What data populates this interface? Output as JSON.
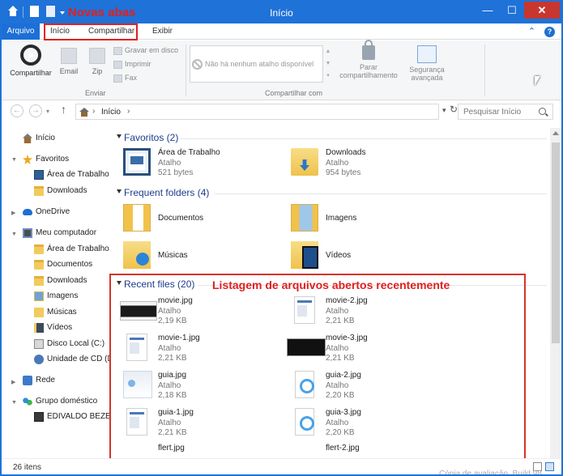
{
  "titlebar": {
    "title": "Início",
    "annotation": "Novas abas",
    "minimize_glyph": "—",
    "maximize_glyph": "☐",
    "close_glyph": "✕"
  },
  "tabs": {
    "arquivo": "Arquivo",
    "inicio": "Início",
    "compartilhar": "Compartilhar",
    "exibir": "Exibir",
    "collapse_glyph": "⌃",
    "help_glyph": "?"
  },
  "ribbon": {
    "compartilhar": "Compartilhar",
    "email": "Email",
    "zip": "Zip",
    "gravar": "Gravar em disco",
    "imprimir": "Imprimir",
    "fax": "Fax",
    "group_enviar": "Enviar",
    "no_share": "Não há nenhum atalho disponível",
    "group_compartilhar": "Compartilhar com",
    "parar_l1": "Parar",
    "parar_l2": "compartilhamento",
    "seg_l1": "Segurança",
    "seg_l2": "avançada"
  },
  "address": {
    "path": "Início",
    "search_placeholder": "Pesquisar Início"
  },
  "nav": {
    "inicio": "Início",
    "favoritos": "Favoritos",
    "area_trabalho": "Área de Trabalho",
    "downloads": "Downloads",
    "onedrive": "OneDrive",
    "meu_computador": "Meu computador",
    "pc_area": "Área de Trabalho",
    "documentos": "Documentos",
    "pc_downloads": "Downloads",
    "imagens": "Imagens",
    "musicas": "Músicas",
    "videos": "Vídeos",
    "disco_local": "Disco Local (C:)",
    "unidade_cd": "Unidade de CD (D",
    "rede": "Rede",
    "grupo": "Grupo doméstico",
    "user": "EDIVALDO BEZER"
  },
  "sections": {
    "favoritos": "Favoritos (2)",
    "frequent": "Frequent folders (4)",
    "recent": "Recent files (20)",
    "recent_annotation": "Listagem de arquivos abertos recentemente"
  },
  "favorites": [
    {
      "name": "Área de Trabalho",
      "type": "Atalho",
      "size": "521 bytes",
      "icon": "desktop-icon"
    },
    {
      "name": "Downloads",
      "type": "Atalho",
      "size": "954 bytes",
      "icon": "downloads-folder-icon"
    }
  ],
  "frequent": [
    {
      "name": "Documentos",
      "icon": "documents-folder-icon"
    },
    {
      "name": "Imagens",
      "icon": "pictures-folder-icon"
    },
    {
      "name": "Músicas",
      "icon": "music-folder-icon"
    },
    {
      "name": "Vídeos",
      "icon": "videos-folder-icon"
    }
  ],
  "recent": [
    {
      "name": "movie.jpg",
      "type": "Atalho",
      "size": "2,19 KB"
    },
    {
      "name": "movie-2.jpg",
      "type": "Atalho",
      "size": "2,21 KB"
    },
    {
      "name": "movie-1.jpg",
      "type": "Atalho",
      "size": "2,21 KB"
    },
    {
      "name": "movie-3.jpg",
      "type": "Atalho",
      "size": "2,21 KB"
    },
    {
      "name": "guia.jpg",
      "type": "Atalho",
      "size": "2,18 KB"
    },
    {
      "name": "guia-2.jpg",
      "type": "Atalho",
      "size": "2,20 KB"
    },
    {
      "name": "guia-1.jpg",
      "type": "Atalho",
      "size": "2,21 KB"
    },
    {
      "name": "guia-3.jpg",
      "type": "Atalho",
      "size": "2,20 KB"
    },
    {
      "name": "flert.jpg",
      "type": "",
      "size": ""
    },
    {
      "name": "flert-2.jpg",
      "type": "",
      "size": ""
    }
  ],
  "status": {
    "count": "26 itens",
    "watermark": "Cópia de avaliação. Build 98"
  },
  "colors": {
    "titlebar": "#1f72d8",
    "annotation_red": "#e02020",
    "section_blue": "#1e3c8c"
  }
}
